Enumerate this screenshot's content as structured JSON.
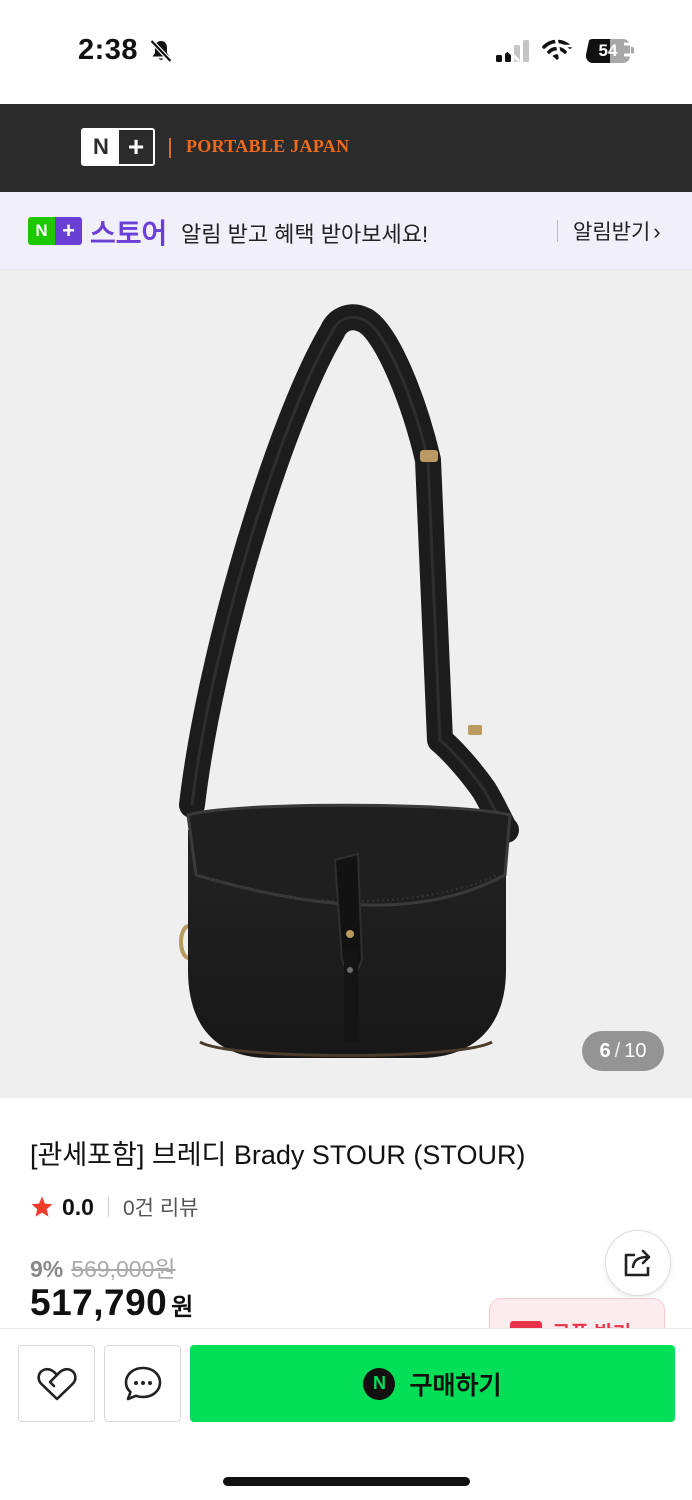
{
  "status_bar": {
    "time": "2:38",
    "battery_level": "54",
    "battery_percent": 54,
    "icons": [
      "bell-slash-icon",
      "cellular-signal-icon",
      "wifi-icon",
      "battery-icon"
    ]
  },
  "header": {
    "logo_text": "N+",
    "brand_name": "PORTABLE JAPAN",
    "icons": [
      "back-arrow-icon",
      "search-icon",
      "shopping-bag-icon",
      "hamburger-menu-icon"
    ],
    "background_color": "#2b2b2b",
    "brand_color": "#f26a1b"
  },
  "notice_banner": {
    "logo_text": "N+",
    "store_word": "스토어",
    "message": "알림 받고 혜택 받아보세요!",
    "link_label": "알림받기",
    "link_chevron": "›"
  },
  "product_image": {
    "current": "6",
    "separator": "/",
    "total": "10",
    "subject": "black canvas shoulder bag with leather strap"
  },
  "product": {
    "title": "[관세포함] 브레디 Brady STOUR (STOUR)",
    "rating": "0.0",
    "review_count": "0건 리뷰",
    "discount_rate": "9%",
    "original_price": "569,000원",
    "sale_price": "517,790",
    "sale_unit": "원",
    "coupon_label": "쿠폰 받기",
    "star_color": "#ee3b2a"
  },
  "bottom_bar": {
    "buy_icon_text": "N",
    "buy_label": "구매하기",
    "buy_color": "#03e058",
    "icons": [
      "heart-icon",
      "chat-bubble-icon"
    ]
  }
}
